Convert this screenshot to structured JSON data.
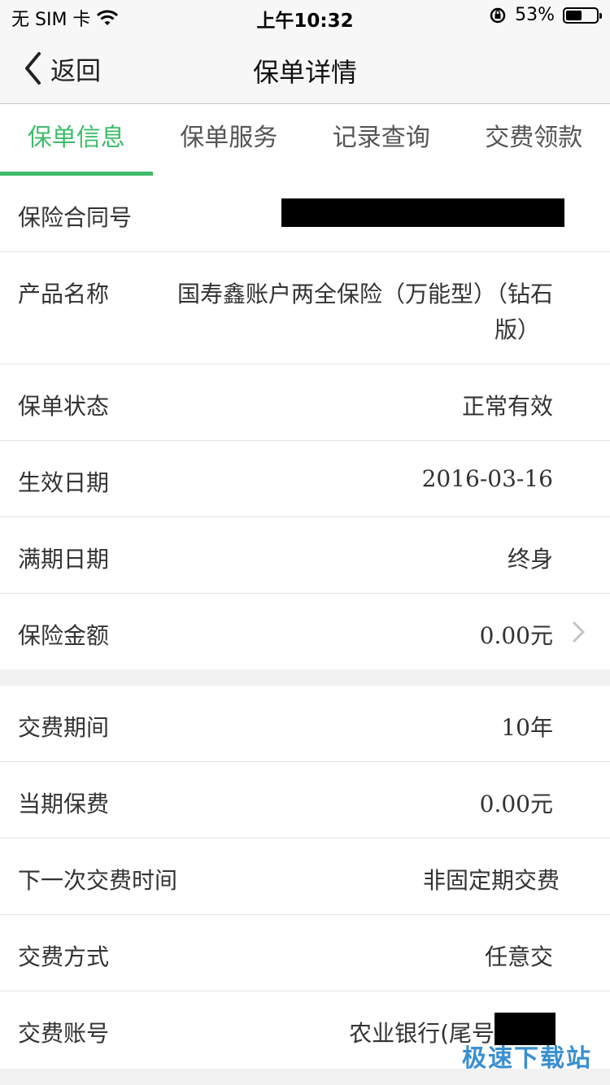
{
  "status_bar": {
    "carrier": "无 SIM 卡",
    "time": "上午10:32",
    "battery_percent": "53%",
    "battery_level": 0.53
  },
  "nav": {
    "back_label": "返回",
    "title": "保单详情"
  },
  "tabs": [
    {
      "label": "保单信息",
      "active": true
    },
    {
      "label": "保单服务",
      "active": false
    },
    {
      "label": "记录查询",
      "active": false
    },
    {
      "label": "交费领款",
      "active": false
    }
  ],
  "policy_info": [
    {
      "label": "保险合同号",
      "value": ""
    },
    {
      "label": "产品名称",
      "value_line1": "国寿鑫账户两全保险（万能型）（钻石",
      "value_line2": "版）"
    },
    {
      "label": "保单状态",
      "value": "正常有效"
    },
    {
      "label": "生效日期",
      "value": "2016-03-16"
    },
    {
      "label": "满期日期",
      "value": "终身"
    },
    {
      "label": "保险金额",
      "value": "0.00元"
    }
  ],
  "payment_info": [
    {
      "label": "交费期间",
      "value": "10年"
    },
    {
      "label": "当期保费",
      "value": "0.00元"
    },
    {
      "label": "下一次交费时间",
      "value": "非固定期交费"
    },
    {
      "label": "交费方式",
      "value": "任意交"
    },
    {
      "label": "交费账号",
      "value": "农业银行(尾号"
    }
  ],
  "watermark": "极速下载站",
  "colors": {
    "accent": "#3ebd6a",
    "watermark": "#3a8fd1"
  }
}
